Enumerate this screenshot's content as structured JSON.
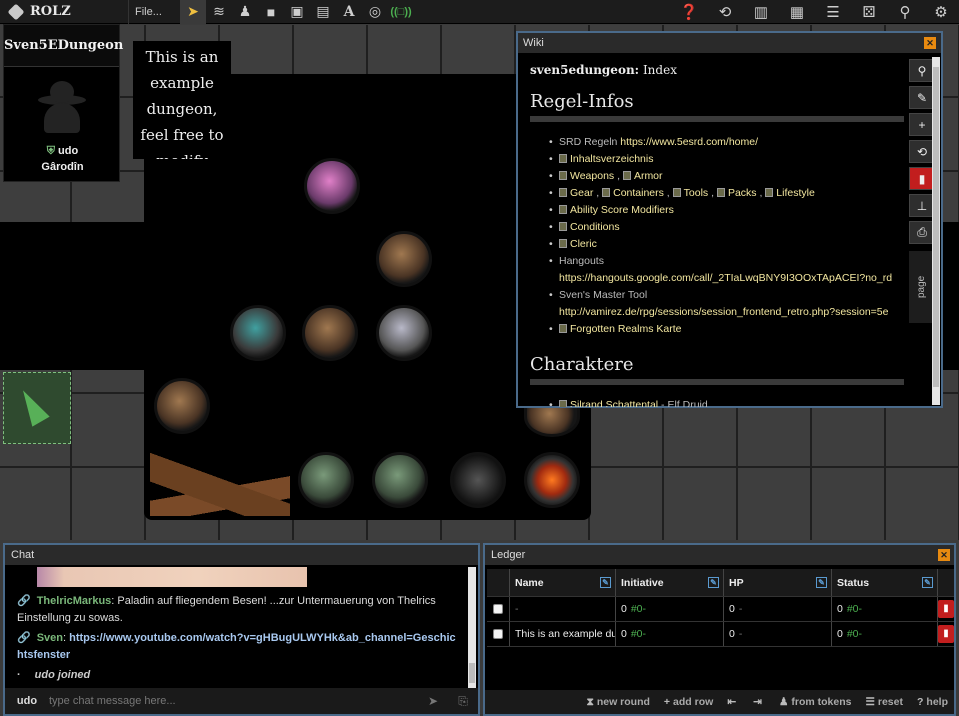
{
  "app": {
    "logo": "ROLZ",
    "file_menu": "File..."
  },
  "toolbar": {
    "tools": [
      "select-tool",
      "marker-tool",
      "stamp-tool",
      "rectangle-tool",
      "image-tool",
      "gallery-tool",
      "text-tool",
      "target-tool",
      "radio-tool"
    ],
    "right_tools": [
      "help",
      "history",
      "wiki",
      "character-sheet",
      "list",
      "dice",
      "pin",
      "settings"
    ],
    "radio_label": "((□))"
  },
  "info_panel": {
    "title": "Sven5EDungeon",
    "player": "udo",
    "character": "Gârodîn"
  },
  "note_card": {
    "text": "This is an example dungeon, feel free to modify"
  },
  "wiki": {
    "panel_title": "Wiki",
    "breadcrumb_page": "sven5edungeon:",
    "breadcrumb_index": "Index",
    "section1": "Regel-Infos",
    "section2": "Charaktere",
    "items": [
      {
        "pre": "SRD Regeln ",
        "links": [
          "https://www.5esrd.com/home/"
        ],
        "book": false
      },
      {
        "pre": "",
        "links": [
          "Inhaltsverzeichnis"
        ],
        "book": true
      },
      {
        "pre": "",
        "links": [
          "Weapons",
          "Armor"
        ],
        "book": true
      },
      {
        "pre": "",
        "links": [
          "Gear",
          "Containers",
          "Tools",
          "Packs",
          "Lifestyle"
        ],
        "book": true
      },
      {
        "pre": "",
        "links": [
          "Ability Score Modifiers"
        ],
        "book": true
      },
      {
        "pre": "",
        "links": [
          "Conditions"
        ],
        "book": true
      },
      {
        "pre": "",
        "links": [
          "Cleric"
        ],
        "book": true
      },
      {
        "pre": "Hangouts",
        "links": [
          "https://hangouts.google.com/call/_2TIaLwqBNY9I3OOxTApACEI?no_rd"
        ],
        "book": false,
        "break": true
      },
      {
        "pre": "Sven's Master Tool",
        "links": [
          "http://vamirez.de/rpg/sessions/session_frontend_retro.php?session=5e"
        ],
        "book": false,
        "break": true
      },
      {
        "pre": "",
        "links": [
          "Forgotten Realms Karte"
        ],
        "book": true
      }
    ],
    "char_item": {
      "link": "Silrand Schattental",
      "suffix": " - Elf Druid"
    },
    "side_buttons": [
      "search",
      "edit",
      "add",
      "history",
      "delete",
      "tree",
      "print"
    ],
    "page_tab": "page"
  },
  "chat": {
    "title": "Chat",
    "messages": [
      {
        "who": "ThelricMarkus",
        "text": ": Paladin auf fliegendem Besen! ...zur Untermauerung von Thelrics Einstellung zu sowas."
      },
      {
        "who": "Sven",
        "text": ": ",
        "link": "https://www.youtube.com/watch?v=gHBugULWYHk&ab_channel=Geschichtsfenster"
      }
    ],
    "system": "udo joined",
    "input_user": "udo",
    "input_placeholder": "type chat message here..."
  },
  "ledger": {
    "title": "Ledger",
    "columns": [
      "Name",
      "Initiative",
      "HP",
      "Status"
    ],
    "rows": [
      {
        "name": "-",
        "init": "0",
        "init_mod": "#0-",
        "hp": "0",
        "hp_mod": "-",
        "status": "0",
        "status_mod": "#0-"
      },
      {
        "name": "This is an example du",
        "init": "0",
        "init_mod": "#0-",
        "hp": "0",
        "hp_mod": "-",
        "status": "0",
        "status_mod": "#0-"
      }
    ],
    "footer": [
      "new round",
      "add row",
      "from tokens",
      "reset",
      "help"
    ]
  },
  "colors": {
    "accent": "#f3e7a0",
    "chat_name": "#7ab77a",
    "link": "#a8c8ef",
    "panel_border": "#4a6a8a",
    "delete": "#c21e1e"
  }
}
